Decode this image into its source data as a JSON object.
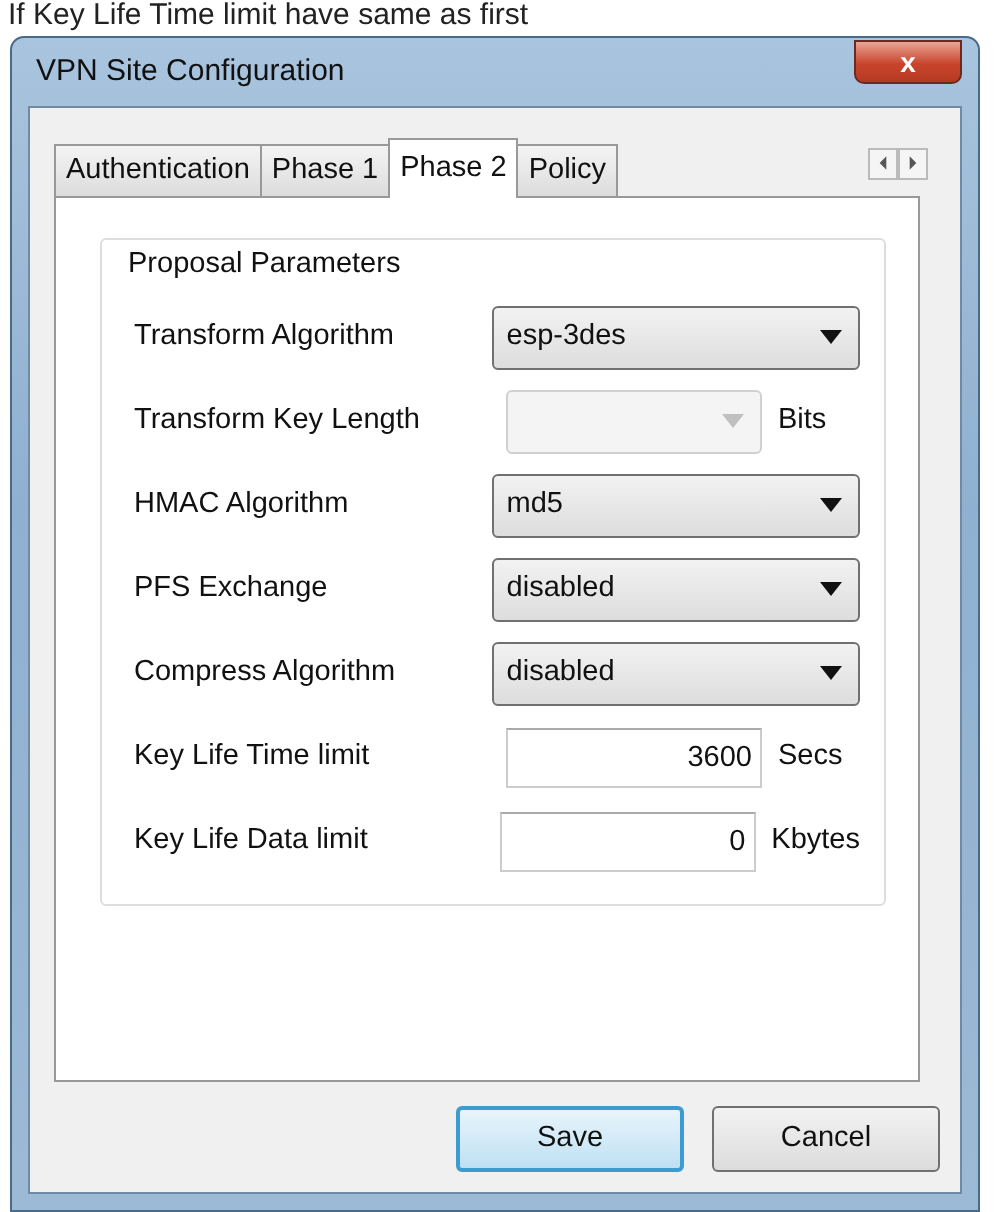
{
  "caption": "If Key Life Time limit have same as first",
  "window": {
    "title": "VPN Site Configuration",
    "close": "x"
  },
  "tabs": [
    {
      "label": "Authentication",
      "selected": false
    },
    {
      "label": "Phase 1",
      "selected": false
    },
    {
      "label": "Phase 2",
      "selected": true
    },
    {
      "label": "Policy",
      "selected": false
    }
  ],
  "group": {
    "title": "Proposal Parameters",
    "rows": [
      {
        "label": "Transform Algorithm",
        "kind": "select",
        "value": "esp-3des",
        "disabled": false
      },
      {
        "label": "Transform Key Length",
        "kind": "select",
        "disabled": true,
        "unit": "Bits"
      },
      {
        "label": "HMAC Algorithm",
        "kind": "select",
        "value": "md5",
        "disabled": false
      },
      {
        "label": "PFS Exchange",
        "kind": "select",
        "value": "disabled",
        "disabled": false
      },
      {
        "label": "Compress Algorithm",
        "kind": "select",
        "value": "disabled",
        "disabled": false
      },
      {
        "label": "Key Life Time limit",
        "kind": "input",
        "value": "3600",
        "unit": "Secs"
      },
      {
        "label": "Key Life Data limit",
        "kind": "input",
        "value": "0",
        "unit": "Kbytes"
      }
    ]
  },
  "buttons": [
    {
      "label": "Save",
      "default": true
    },
    {
      "label": "Cancel",
      "default": false
    }
  ]
}
